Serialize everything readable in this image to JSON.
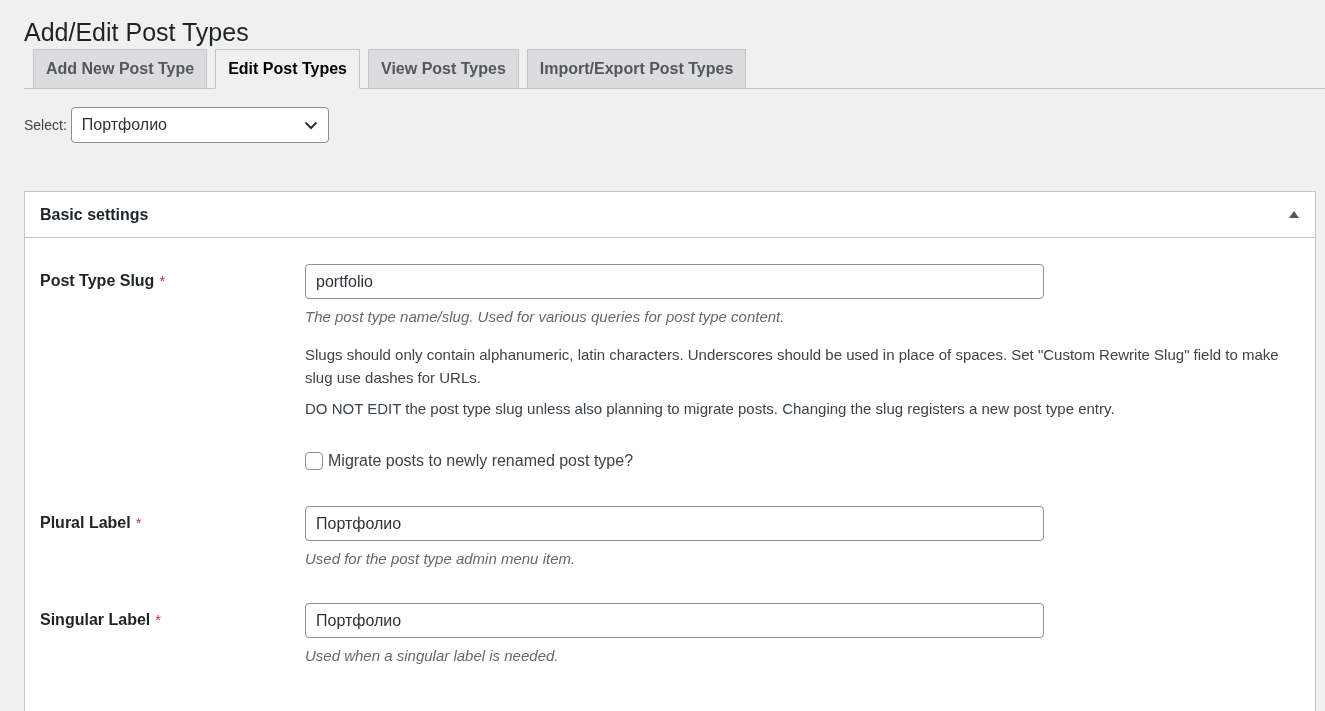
{
  "page_title": "Add/Edit Post Types",
  "tabs": [
    {
      "label": "Add New Post Type",
      "selected": false
    },
    {
      "label": "Edit Post Types",
      "selected": true
    },
    {
      "label": "View Post Types",
      "selected": false
    },
    {
      "label": "Import/Export Post Types",
      "selected": false
    }
  ],
  "select": {
    "label": "Select:",
    "value": "Портфолио"
  },
  "panel": {
    "title": "Basic settings",
    "expanded": true,
    "fields": [
      {
        "label": "Post Type Slug",
        "required_mark": "*",
        "value": "portfolio",
        "description": "The post type name/slug. Used for various queries for post type content.",
        "notes": [
          "Slugs should only contain alphanumeric, latin characters. Underscores should be used in place of spaces. Set \"Custom Rewrite Slug\" field to make slug use dashes for URLs.",
          "DO NOT EDIT the post type slug unless also planning to migrate posts. Changing the slug registers a new post type entry."
        ],
        "checkbox": {
          "label": "Migrate posts to newly renamed post type?",
          "checked": false
        }
      },
      {
        "label": "Plural Label",
        "required_mark": "*",
        "value": "Портфолио",
        "description": "Used for the post type admin menu item."
      },
      {
        "label": "Singular Label",
        "required_mark": "*",
        "value": "Портфолио",
        "description": "Used when a singular label is needed."
      }
    ]
  }
}
